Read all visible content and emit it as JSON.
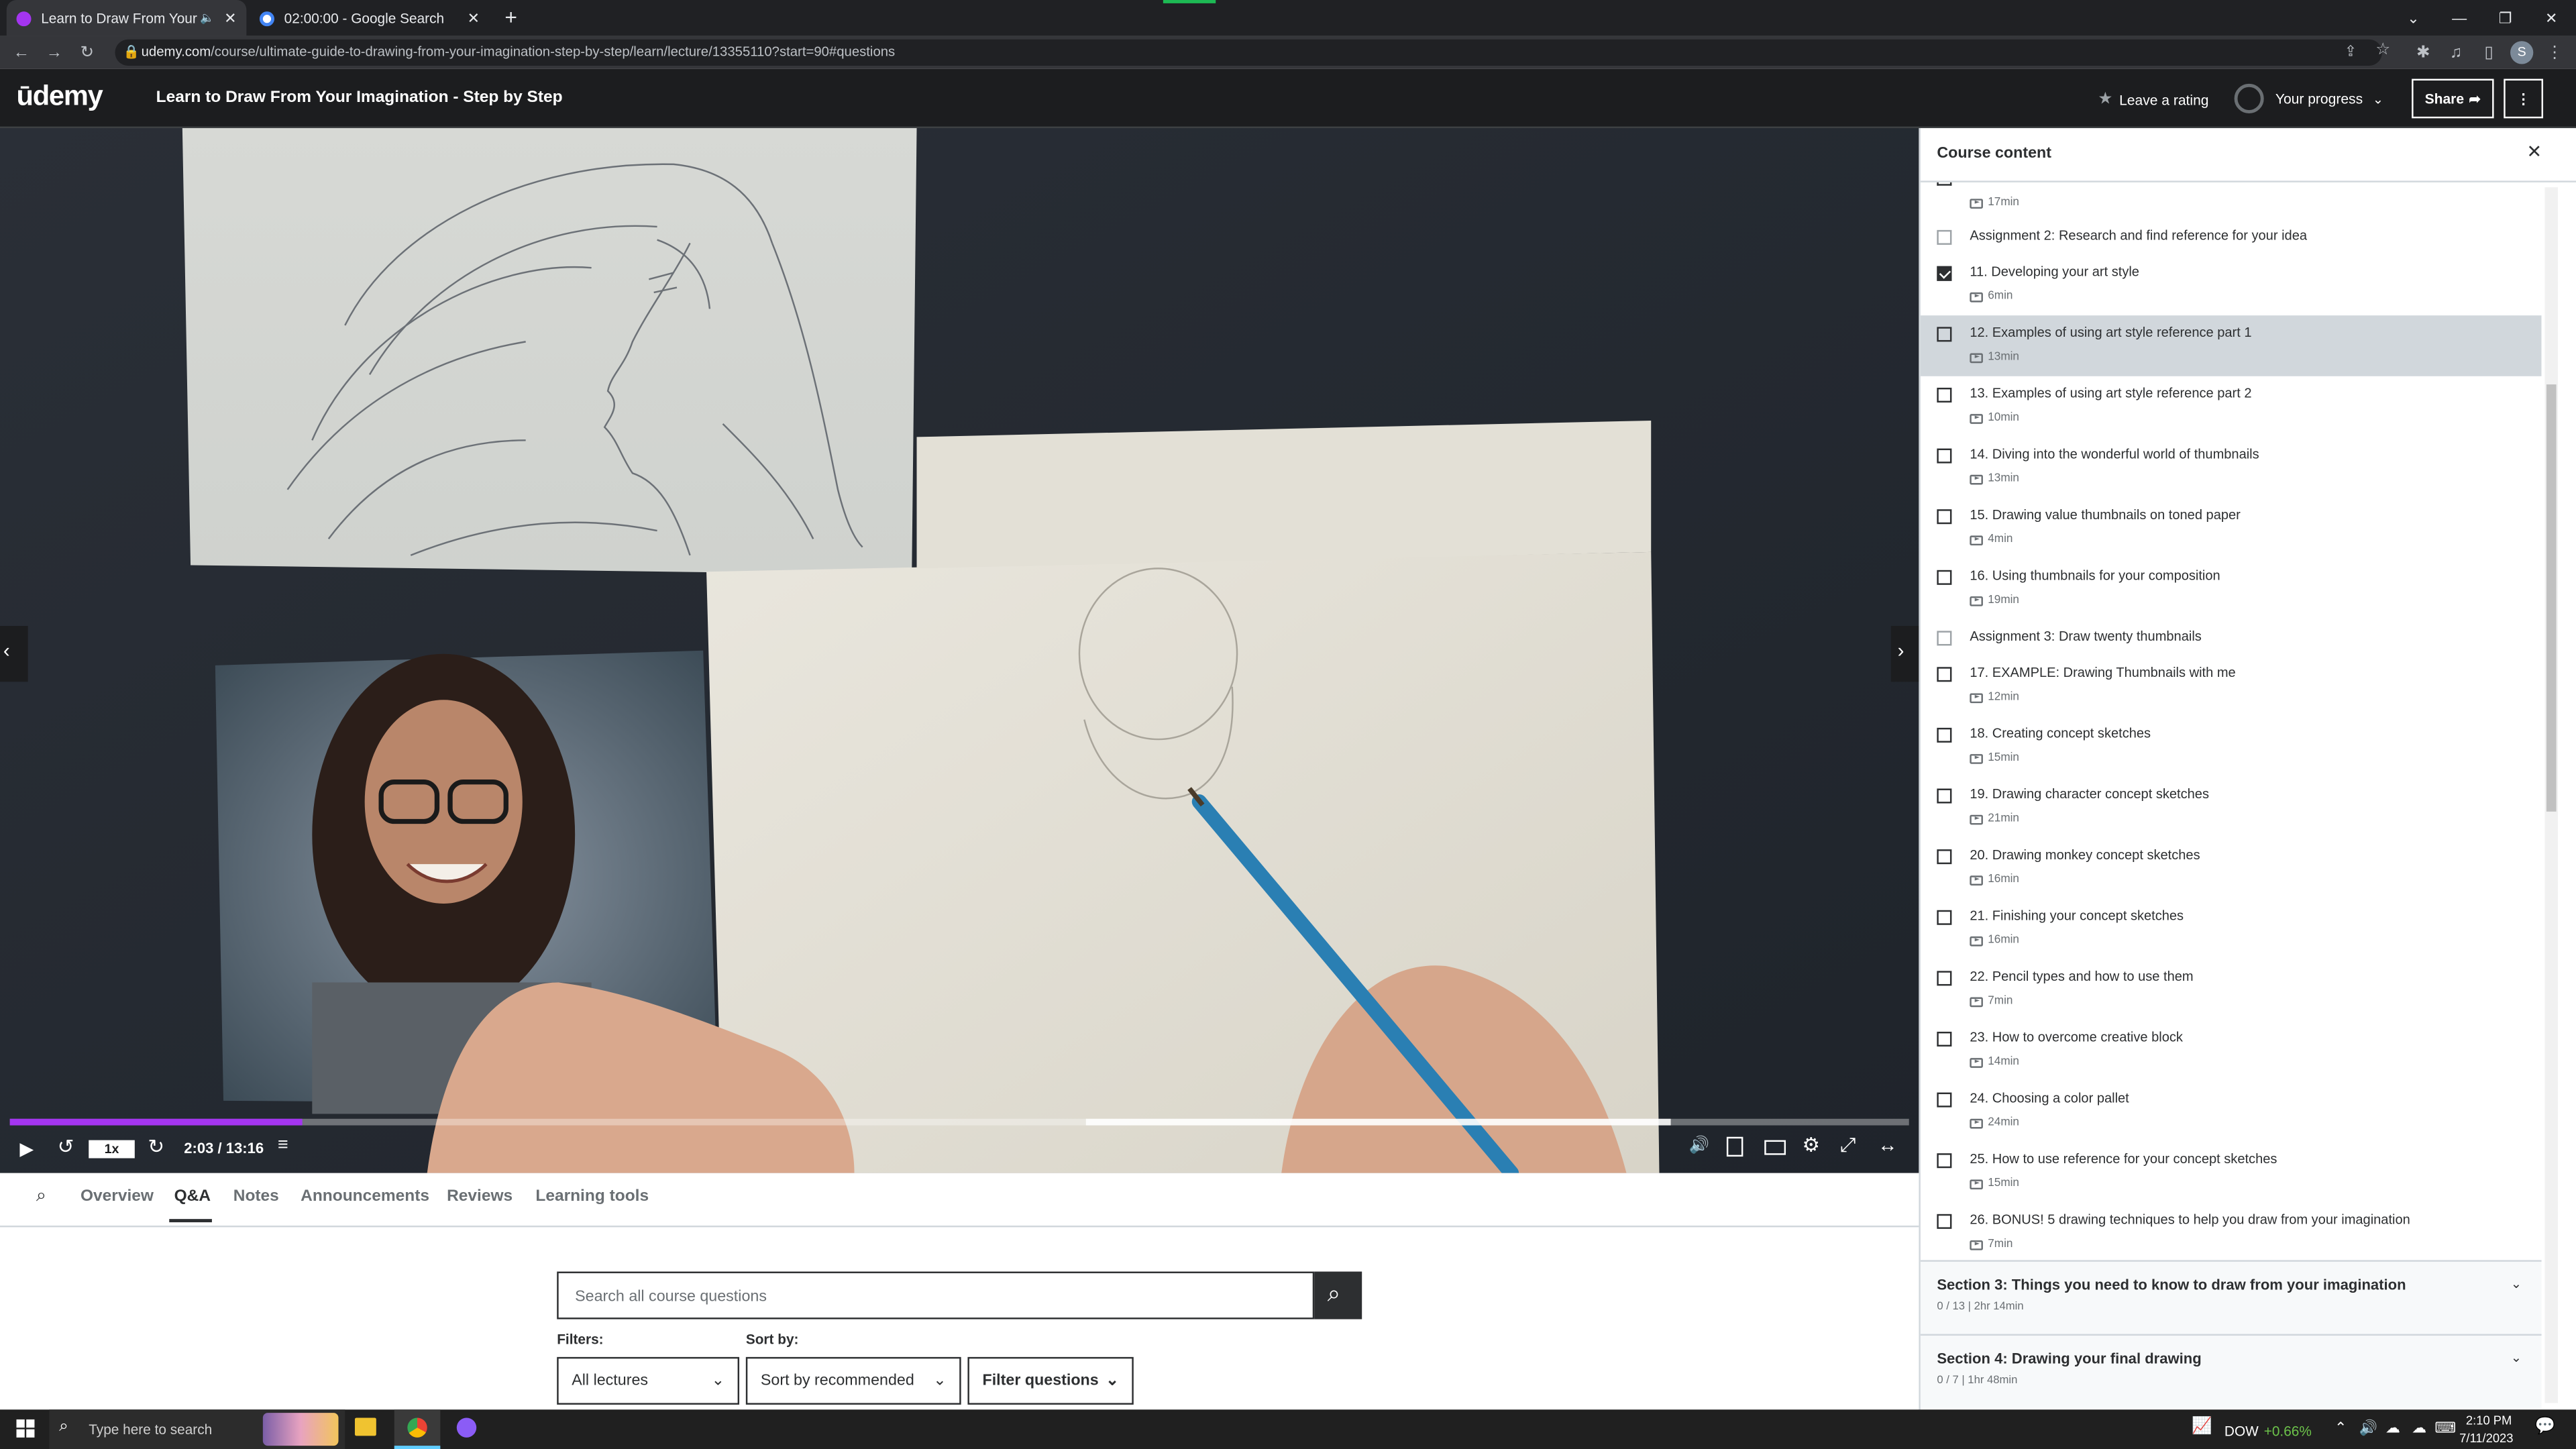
{
  "browser": {
    "tabs": [
      {
        "title": "Learn to Draw From Your Im",
        "active": true
      },
      {
        "title": "02:00:00 - Google Search",
        "active": false
      }
    ],
    "url_host": "udemy.com",
    "url_path": "/course/ultimate-guide-to-drawing-from-your-imagination-step-by-step/learn/lecture/13355110?start=90#questions"
  },
  "header": {
    "logo": "ūdemy",
    "course_title": "Learn to Draw From Your Imagination - Step by Step",
    "leave_rating": "Leave a rating",
    "your_progress": "Your progress",
    "share": "Share"
  },
  "player": {
    "speed": "1x",
    "time": "2:03 / 13:16",
    "progress_fraction": 0.154
  },
  "lower_tabs": [
    "Overview",
    "Q&A",
    "Notes",
    "Announcements",
    "Reviews",
    "Learning tools"
  ],
  "qa": {
    "search_placeholder": "Search all course questions",
    "filters_label": "Filters:",
    "sortby_label": "Sort by:",
    "filter_value": "All lectures",
    "sort_value": "Sort by recommended",
    "filter_questions": "Filter questions"
  },
  "sidebar": {
    "title": "Course content",
    "top_partial_duration": "17min",
    "items": [
      {
        "title": "Assignment 2: Research and find reference for your idea",
        "duration": "",
        "checked": false,
        "assignment": true
      },
      {
        "title": "11. Developing your art style",
        "duration": "6min",
        "checked": true
      },
      {
        "title": "12. Examples of using art style reference part 1",
        "duration": "13min",
        "checked": false,
        "current": true
      },
      {
        "title": "13. Examples of using art style reference part 2",
        "duration": "10min",
        "checked": false
      },
      {
        "title": "14. Diving into the wonderful world of thumbnails",
        "duration": "13min",
        "checked": false
      },
      {
        "title": "15. Drawing value thumbnails on toned paper",
        "duration": "4min",
        "checked": false
      },
      {
        "title": "16. Using thumbnails for your composition",
        "duration": "19min",
        "checked": false
      },
      {
        "title": "Assignment 3: Draw twenty thumbnails",
        "duration": "",
        "checked": false,
        "assignment": true
      },
      {
        "title": "17. EXAMPLE: Drawing Thumbnails with me",
        "duration": "12min",
        "checked": false
      },
      {
        "title": "18. Creating concept sketches",
        "duration": "15min",
        "checked": false
      },
      {
        "title": "19. Drawing character concept sketches",
        "duration": "21min",
        "checked": false
      },
      {
        "title": "20. Drawing monkey concept sketches",
        "duration": "16min",
        "checked": false
      },
      {
        "title": "21. Finishing your concept sketches",
        "duration": "16min",
        "checked": false
      },
      {
        "title": "22. Pencil types and how to use them",
        "duration": "7min",
        "checked": false
      },
      {
        "title": "23. How to overcome creative block",
        "duration": "14min",
        "checked": false
      },
      {
        "title": "24. Choosing a color pallet",
        "duration": "24min",
        "checked": false
      },
      {
        "title": "25. How to use reference for your concept sketches",
        "duration": "15min",
        "checked": false
      },
      {
        "title": "26. BONUS! 5 drawing techniques to help you draw from your imagination",
        "duration": "7min",
        "checked": false
      }
    ],
    "sections": [
      {
        "title": "Section 3: Things you need to know to draw from your imagination",
        "sub": "0 / 13 | 2hr 14min"
      },
      {
        "title": "Section 4: Drawing your final drawing",
        "sub": "0 / 7 | 1hr 48min"
      }
    ]
  },
  "taskbar": {
    "search_placeholder": "Type here to search",
    "ticker": "DOW",
    "ticker_change": "+0.66%",
    "time": "2:10 PM",
    "date": "7/11/2023"
  },
  "colors": {
    "accent": "#a435f0",
    "dark": "#1c1d1f",
    "ticker_up": "#6cc24a"
  }
}
